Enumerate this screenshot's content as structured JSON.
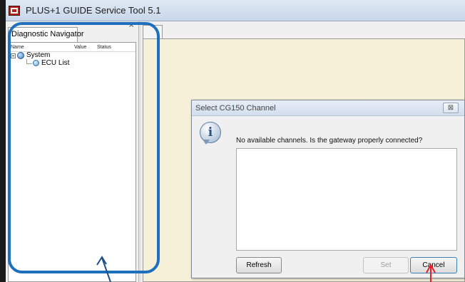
{
  "window": {
    "title": "PLUS+1 GUIDE Service Tool 5.1"
  },
  "navigator": {
    "close_glyph": "×",
    "tab_label": "Diagnostic Navigator",
    "columns": [
      "Name",
      "Value",
      "Status"
    ],
    "tree": {
      "root_label": "System",
      "child_label": "ECU List"
    }
  },
  "dialog": {
    "title": "Select CG150 Channel",
    "close_glyph": "⊠",
    "icon": "info-icon",
    "message": "No available channels. Is the gateway properly connected?",
    "buttons": {
      "refresh": "Refresh",
      "set": "Set",
      "cancel": "Cancel"
    }
  },
  "colors": {
    "highlight": "#1f6fbf",
    "arrow_red": "#e41e26",
    "doc_pane": "#f5f0d7"
  }
}
